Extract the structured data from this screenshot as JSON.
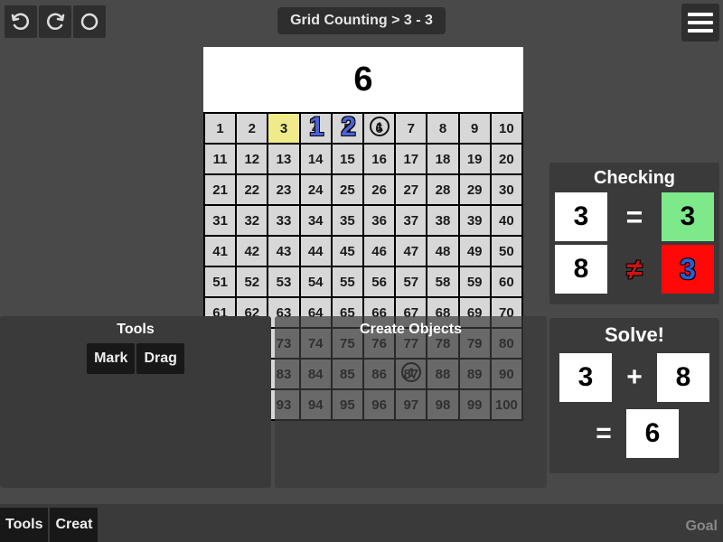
{
  "header": {
    "breadcrumb": "Grid Counting > 3 - 3",
    "undo_icon": "undo",
    "redo_icon": "redo",
    "status_icon": "circle",
    "menu_icon": "menu"
  },
  "display_number": "6",
  "grid": {
    "rows": 10,
    "cols": 10,
    "start": 1,
    "highlighted": [
      3
    ],
    "overlay_blue": [
      {
        "cell": 4,
        "text": "1"
      },
      {
        "cell": 5,
        "text": "2"
      }
    ],
    "overlay_circles": [
      {
        "cell": 6,
        "text": "1"
      },
      {
        "cell": 87,
        "text": "1"
      }
    ]
  },
  "tools": {
    "title": "Tools",
    "buttons": [
      "Mark",
      "Drag"
    ]
  },
  "create": {
    "title": "Create Objects"
  },
  "checking": {
    "title": "Checking",
    "rows": [
      {
        "left": "3",
        "op": "=",
        "op_type": "eq",
        "right": "3",
        "right_style": "green"
      },
      {
        "left": "8",
        "op": "≠",
        "op_type": "neq",
        "right": "3",
        "right_style": "red"
      }
    ]
  },
  "solve": {
    "title": "Solve!",
    "expr": {
      "a": "3",
      "op": "+",
      "b": "8"
    },
    "result": {
      "op": "=",
      "val": "6"
    }
  },
  "bottom": {
    "left": [
      "Tools",
      "Creat"
    ],
    "right": "Goal"
  }
}
